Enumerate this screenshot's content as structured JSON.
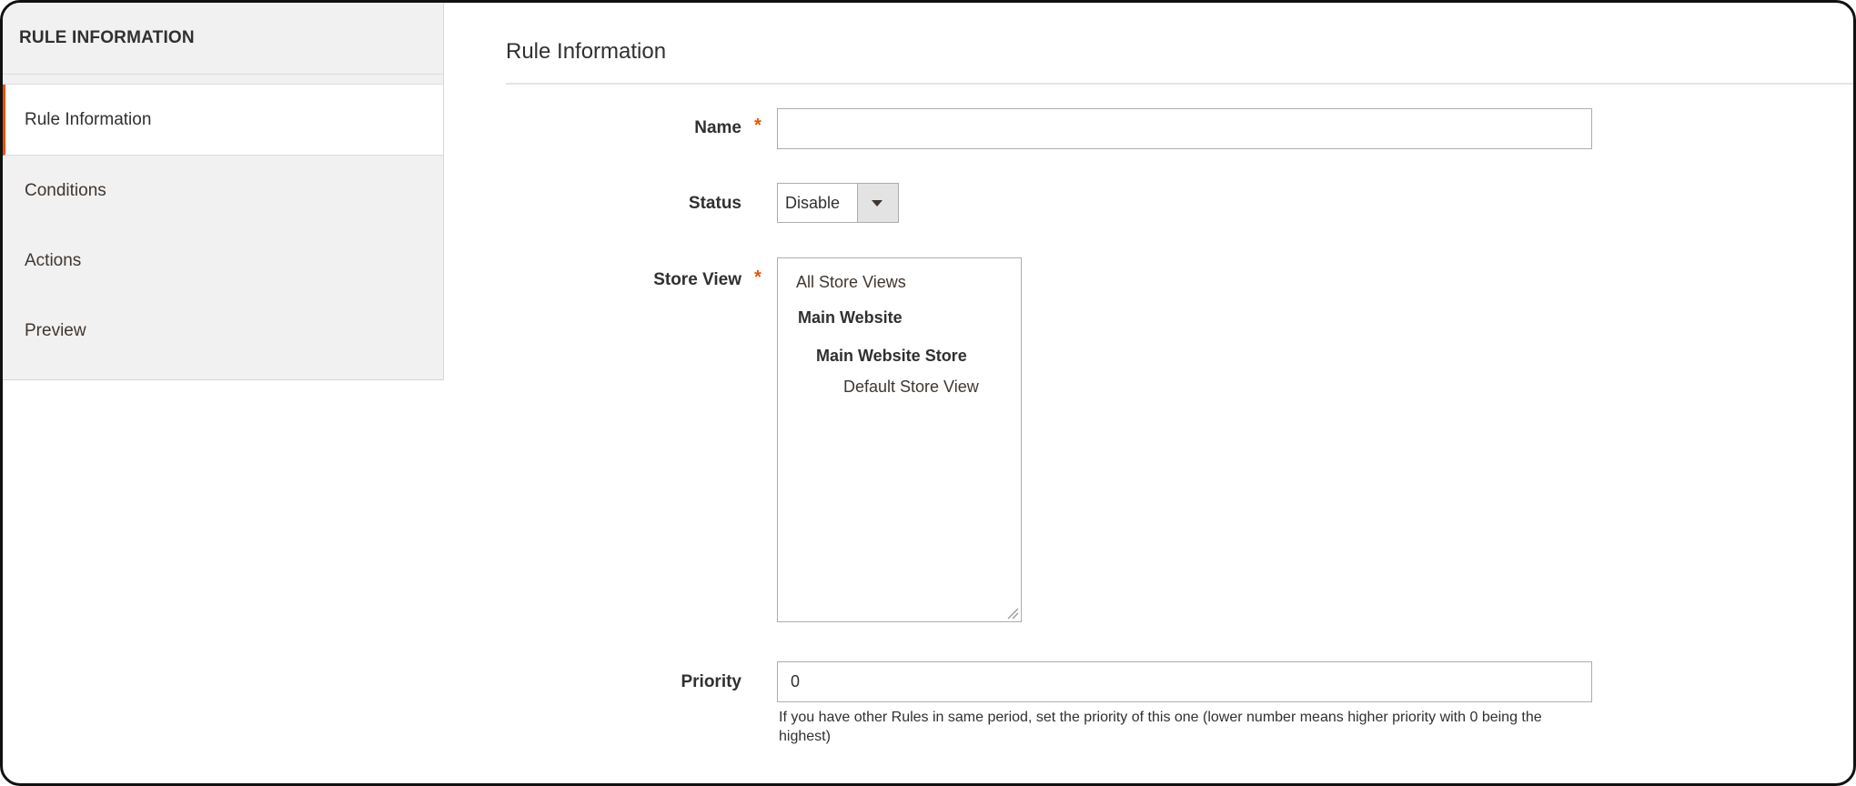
{
  "sidebar": {
    "title": "RULE INFORMATION",
    "items": [
      {
        "label": "Rule Information",
        "active": true
      },
      {
        "label": "Conditions",
        "active": false
      },
      {
        "label": "Actions",
        "active": false
      },
      {
        "label": "Preview",
        "active": false
      }
    ]
  },
  "main": {
    "section_title": "Rule Information",
    "fields": {
      "name": {
        "label": "Name",
        "required": true,
        "value": ""
      },
      "status": {
        "label": "Status",
        "value": "Disable"
      },
      "store_view": {
        "label": "Store View",
        "required": true,
        "options": [
          {
            "label": "All Store Views"
          },
          {
            "label": "Main Website"
          },
          {
            "label": "Main Website Store"
          },
          {
            "label": "Default Store View"
          }
        ]
      },
      "priority": {
        "label": "Priority",
        "value": "0",
        "note": "If you have other Rules in same period, set the priority of this one (lower number means higher priority with 0 being the highest)"
      }
    },
    "required_marker": "*"
  },
  "colors": {
    "accent": "#eb5202",
    "sidebar_bg": "#f1f1f1",
    "text": "#303030"
  }
}
